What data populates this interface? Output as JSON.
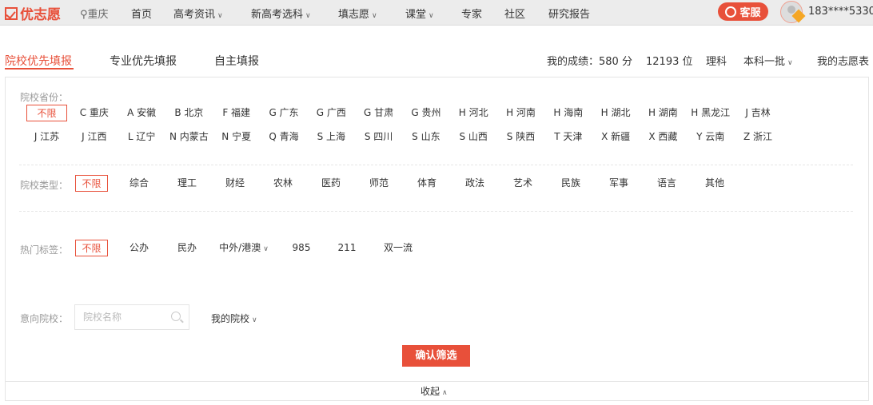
{
  "header": {
    "logo": "优志愿",
    "location": "重庆",
    "nav": [
      {
        "label": "首页",
        "dd": false
      },
      {
        "label": "高考资讯",
        "dd": true
      },
      {
        "label": "新高考选科",
        "dd": true
      },
      {
        "label": "填志愿",
        "dd": true
      },
      {
        "label": "课堂",
        "dd": true
      },
      {
        "label": "专家",
        "dd": false
      },
      {
        "label": "社区",
        "dd": false
      },
      {
        "label": "研究报告",
        "dd": false
      }
    ],
    "service": "客服",
    "user": "183****5330"
  },
  "tabs": [
    "院校优先填报",
    "专业优先填报",
    "自主填报"
  ],
  "info": {
    "score": "我的成绩：580 分",
    "rank": "12193 位",
    "subject": "理科",
    "batch": "本科一批",
    "my_list": "我的志愿表"
  },
  "filters": {
    "province_label": "院校省份：",
    "provinces": [
      "不限",
      "C 重庆",
      "A 安徽",
      "B 北京",
      "F 福建",
      "G 广东",
      "G 广西",
      "G 甘肃",
      "G 贵州",
      "H 河北",
      "H 河南",
      "H 海南",
      "H 湖北",
      "H 湖南",
      "H 黑龙江",
      "J 吉林",
      "J 江苏",
      "J 江西",
      "L 辽宁",
      "N 内蒙古",
      "N 宁夏",
      "Q 青海",
      "S 上海",
      "S 四川",
      "S 山东",
      "S 山西",
      "S 陕西",
      "T 天津",
      "X 新疆",
      "X 西藏",
      "Y 云南",
      "Z 浙江"
    ],
    "type_label": "院校类型：",
    "types": [
      "不限",
      "综合",
      "理工",
      "财经",
      "农林",
      "医药",
      "师范",
      "体育",
      "政法",
      "艺术",
      "民族",
      "军事",
      "语言",
      "其他"
    ],
    "tag_label": "热门标签：",
    "tags": [
      "不限",
      "公办",
      "民办",
      "中外/港澳",
      "985",
      "211",
      "双一流"
    ],
    "intent_label": "意向院校：",
    "search_placeholder": "院校名称",
    "my_schools": "我的院校",
    "confirm": "确认筛选",
    "collapse": "收起"
  },
  "colors": {
    "accent": "#e8503a"
  }
}
